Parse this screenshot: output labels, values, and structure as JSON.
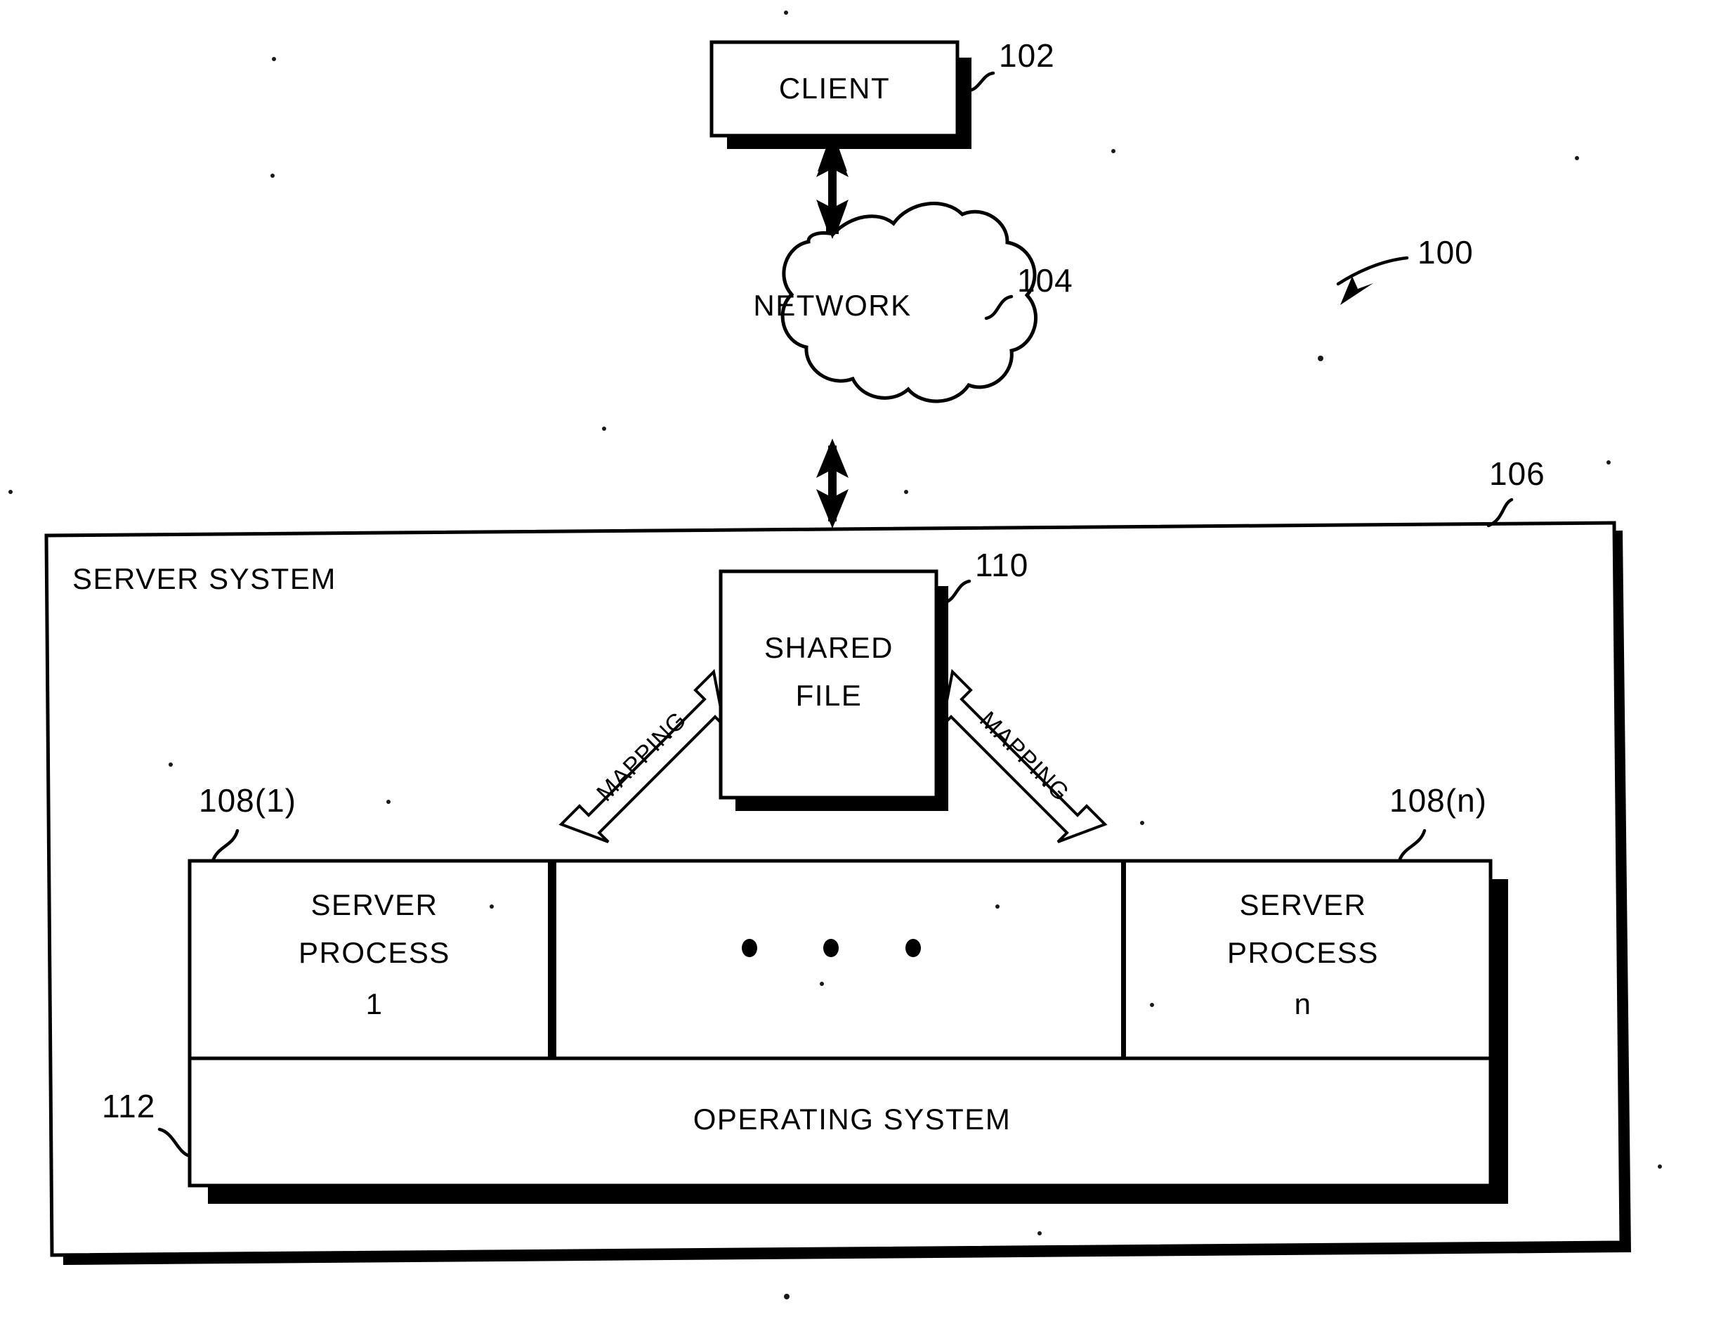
{
  "figure": {
    "reference_numeral": "100",
    "nodes": {
      "client": {
        "label": "CLIENT",
        "ref": "102"
      },
      "network": {
        "label": "NETWORK",
        "ref": "104"
      },
      "server_system": {
        "label": "SERVER SYSTEM",
        "ref": "106"
      },
      "shared_file": {
        "label_line1": "SHARED",
        "label_line2": "FILE",
        "ref": "110"
      },
      "server_process_first": {
        "label_line1": "SERVER",
        "label_line2": "PROCESS",
        "label_line3": "1",
        "ref": "108(1)"
      },
      "server_process_last": {
        "label_line1": "SERVER",
        "label_line2": "PROCESS",
        "label_line3": "n",
        "ref": "108(n)"
      },
      "operating_system": {
        "label": "OPERATING SYSTEM",
        "ref": "112"
      }
    },
    "connectors": {
      "client_to_network": {
        "style": "double-headed-arrow"
      },
      "network_to_server_system": {
        "style": "double-headed-arrow"
      },
      "mapping_left": {
        "label": "MAPPING",
        "style": "double-headed-block-arrow"
      },
      "mapping_right": {
        "label": "MAPPING",
        "style": "double-headed-block-arrow"
      }
    },
    "ellipsis": "• • •",
    "colors": {
      "ink": "#000000",
      "paper": "#ffffff"
    }
  }
}
